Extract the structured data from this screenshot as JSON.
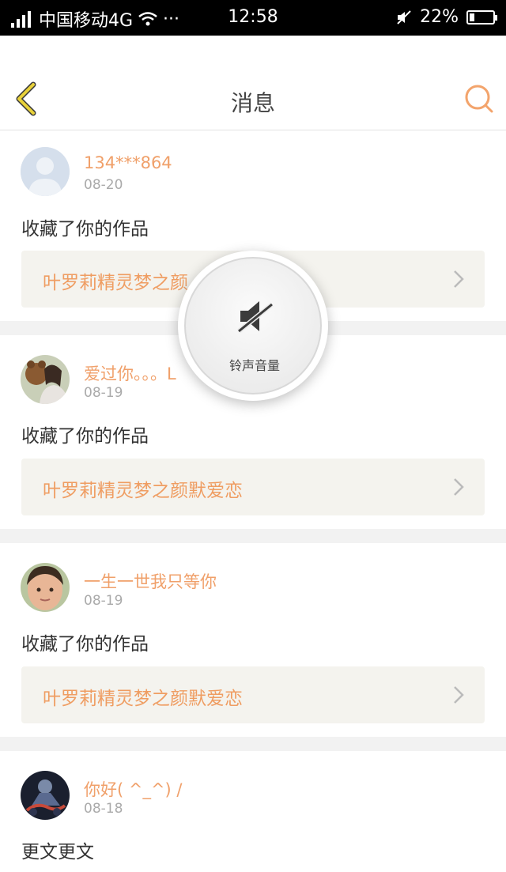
{
  "status_bar": {
    "carrier": "中国移动4G",
    "dots": "···",
    "time": "12:58",
    "battery": "22%",
    "battery_level": 0.22
  },
  "header": {
    "title": "消息"
  },
  "messages": [
    {
      "name": "134***864",
      "date": "08-20",
      "action": "收藏了你的作品",
      "work_title": "叶罗莉精灵梦之颜"
    },
    {
      "name": "爱过你。。。L",
      "date": "08-19",
      "action": "收藏了你的作品",
      "work_title": "叶罗莉精灵梦之颜默爱恋"
    },
    {
      "name": "一生一世我只等你",
      "date": "08-19",
      "action": "收藏了你的作品",
      "work_title": "叶罗莉精灵梦之颜默爱恋"
    },
    {
      "name": "你好( ^_^) /",
      "date": "08-18",
      "action": "更文更文"
    }
  ],
  "volume_toast": {
    "label": "铃声音量",
    "icon": "speaker-muted-icon"
  },
  "colors": {
    "accent": "#f0a06a",
    "back_icon": "#e8d13a",
    "search_icon": "#f3a46c",
    "card_bg": "#f4f3ee"
  }
}
